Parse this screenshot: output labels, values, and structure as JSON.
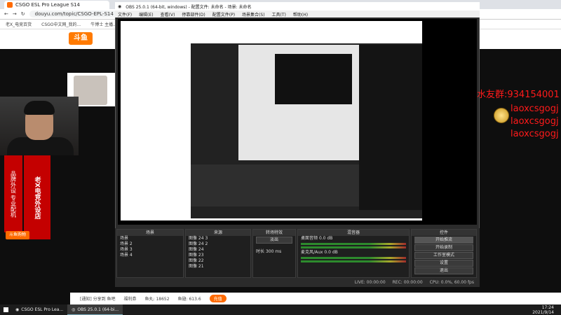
{
  "browser": {
    "tab_title": "CSGO ESL Pro League S14",
    "url": "douyu.com/topic/CSGO-EPL-S14",
    "bookmarks": [
      "老X_电竞百货",
      "CSGO中文网_我的...",
      "牛博士 主播..."
    ]
  },
  "douyu": {
    "logo": "斗鱼",
    "left_banner_main": "老X电竞外设店",
    "left_banner_side": "品牌外设 专业配机",
    "shop_label": "斗鱼购物"
  },
  "obs": {
    "title": "OBS 25.0.1 (64-bit, windows) - 配置文件: 未命名 - 场景: 未命名",
    "menu": [
      "文件(F)",
      "编辑(E)",
      "查看(V)",
      "停靠部件(D)",
      "配置文件(P)",
      "场景集合(S)",
      "工具(T)",
      "帮助(H)"
    ],
    "docks": {
      "scenes_title": "场景",
      "scenes": [
        "场景",
        "场景 2",
        "场景 3",
        "场景 4"
      ],
      "sources_title": "来源",
      "sources": [
        "图像 24 3",
        "图像 24 2",
        "图像 24",
        "图像 23",
        "图像 22",
        "图像 21"
      ],
      "transitions_title": "转场特效",
      "transition_type": "淡出",
      "duration_label": "时长",
      "duration_value": "300 ms",
      "mixer_title": "混音器",
      "mixer_tracks": [
        "桌面音频",
        "麦克风/Aux"
      ],
      "mixer_db": [
        "0.0 dB",
        "0.0 dB"
      ],
      "controls_title": "控件",
      "controls": [
        "开始推流",
        "开始录制",
        "工作室模式",
        "设置",
        "退出"
      ]
    },
    "status": {
      "live": "LIVE: 00:00:00",
      "rec": "REC: 00:00:00",
      "cpu": "CPU: 0.0%, 60.00 fps"
    }
  },
  "overlay": {
    "fan_group_prefix": "水友群:",
    "fan_group_number": "934154001",
    "handle": "laoxcsgogj"
  },
  "chatbar": {
    "items": [
      "[通知] 分享到 鱼吧",
      "福利券",
      "鱼丸: 18652",
      "鱼翅: 613.6",
      "充值"
    ]
  },
  "taskbar": {
    "items": [
      "CSGO ESL Pro Lea...",
      "OBS 25.0.1 (64-bi..."
    ],
    "time": "17:24",
    "date": "2021/9/14"
  }
}
